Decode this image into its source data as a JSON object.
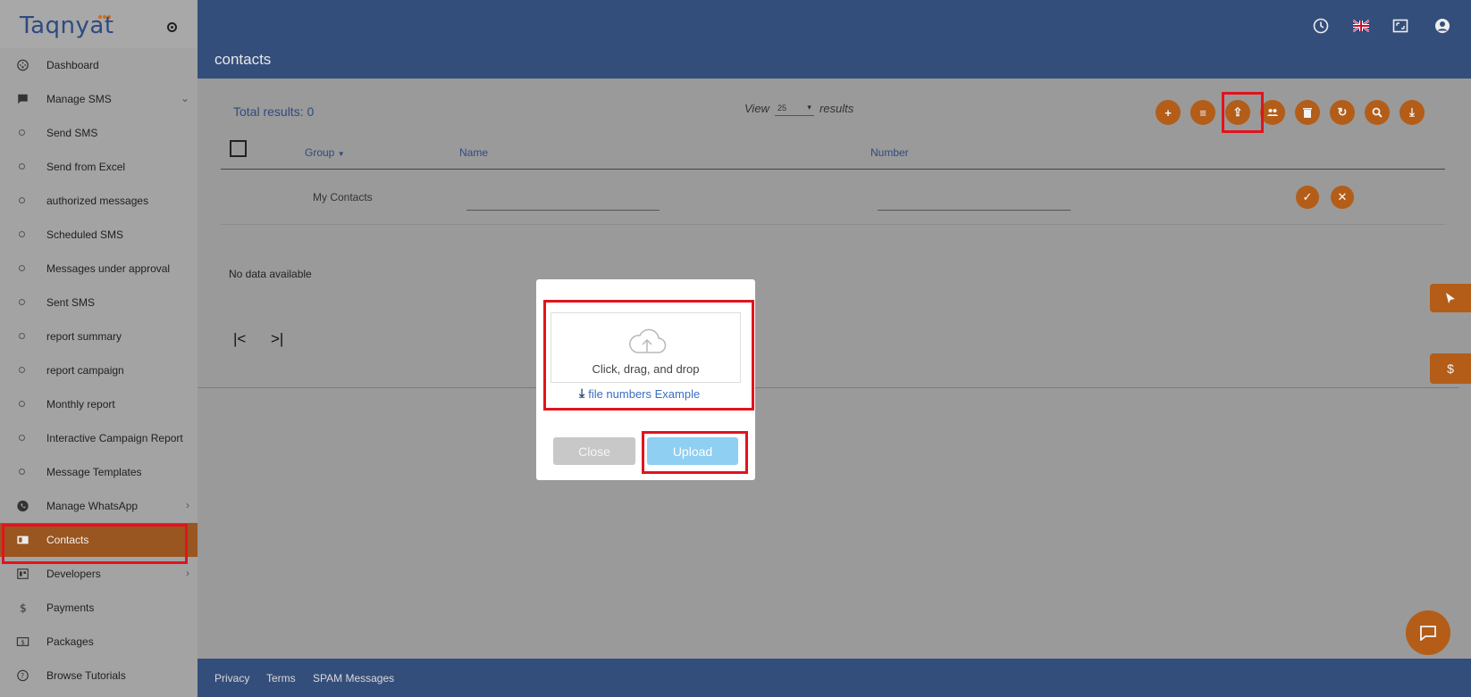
{
  "logo": {
    "text": "Taqnyat"
  },
  "sidebar": {
    "items": [
      {
        "label": "Dashboard",
        "icon": "dashboard-icon",
        "type": "main"
      },
      {
        "label": "Manage SMS",
        "icon": "message-icon",
        "type": "main",
        "chevron": "⌄"
      },
      {
        "label": "Send SMS",
        "type": "sub"
      },
      {
        "label": "Send from Excel",
        "type": "sub"
      },
      {
        "label": "authorized messages",
        "type": "sub"
      },
      {
        "label": "Scheduled SMS",
        "type": "sub"
      },
      {
        "label": "Messages under approval",
        "type": "sub"
      },
      {
        "label": "Sent SMS",
        "type": "sub"
      },
      {
        "label": "report summary",
        "type": "sub"
      },
      {
        "label": "report campaign",
        "type": "sub"
      },
      {
        "label": "Monthly report",
        "type": "sub"
      },
      {
        "label": "Interactive Campaign Report",
        "type": "sub"
      },
      {
        "label": "Message Templates",
        "type": "sub"
      },
      {
        "label": "Manage WhatsApp",
        "icon": "whatsapp-icon",
        "type": "main",
        "chevron": "›"
      },
      {
        "label": "Contacts",
        "icon": "contacts-book-icon",
        "type": "main",
        "active": true
      },
      {
        "label": "Developers",
        "icon": "developers-icon",
        "type": "main",
        "chevron": "›"
      },
      {
        "label": "Payments",
        "icon": "dollar-icon",
        "type": "main"
      },
      {
        "label": "Packages",
        "icon": "package-icon",
        "type": "main"
      },
      {
        "label": "Browse Tutorials",
        "icon": "help-circle-icon",
        "type": "main"
      }
    ]
  },
  "header": {
    "title": "contacts"
  },
  "toolbar": {
    "total_results": "Total results: 0",
    "view_label": "View",
    "page_size": "25",
    "results_label": "results"
  },
  "table": {
    "columns": {
      "group": "Group",
      "name": "Name",
      "number": "Number"
    },
    "new_row_group": "My Contacts",
    "no_data": "No data available"
  },
  "pager": {
    "first": "|<",
    "last": ">|"
  },
  "modal": {
    "drop_text": "Click, drag, and drop",
    "example_link": "file numbers Example",
    "close_label": "Close",
    "upload_label": "Upload"
  },
  "side_tabs": {
    "dollar": "$"
  },
  "footer": {
    "privacy": "Privacy",
    "terms": "Terms",
    "spam": "SPAM Messages"
  },
  "colors": {
    "brand_blue": "#344e7b",
    "accent_orange": "#b35d18",
    "highlight_red": "#e0141e",
    "upload_blue": "#8ecff2"
  }
}
